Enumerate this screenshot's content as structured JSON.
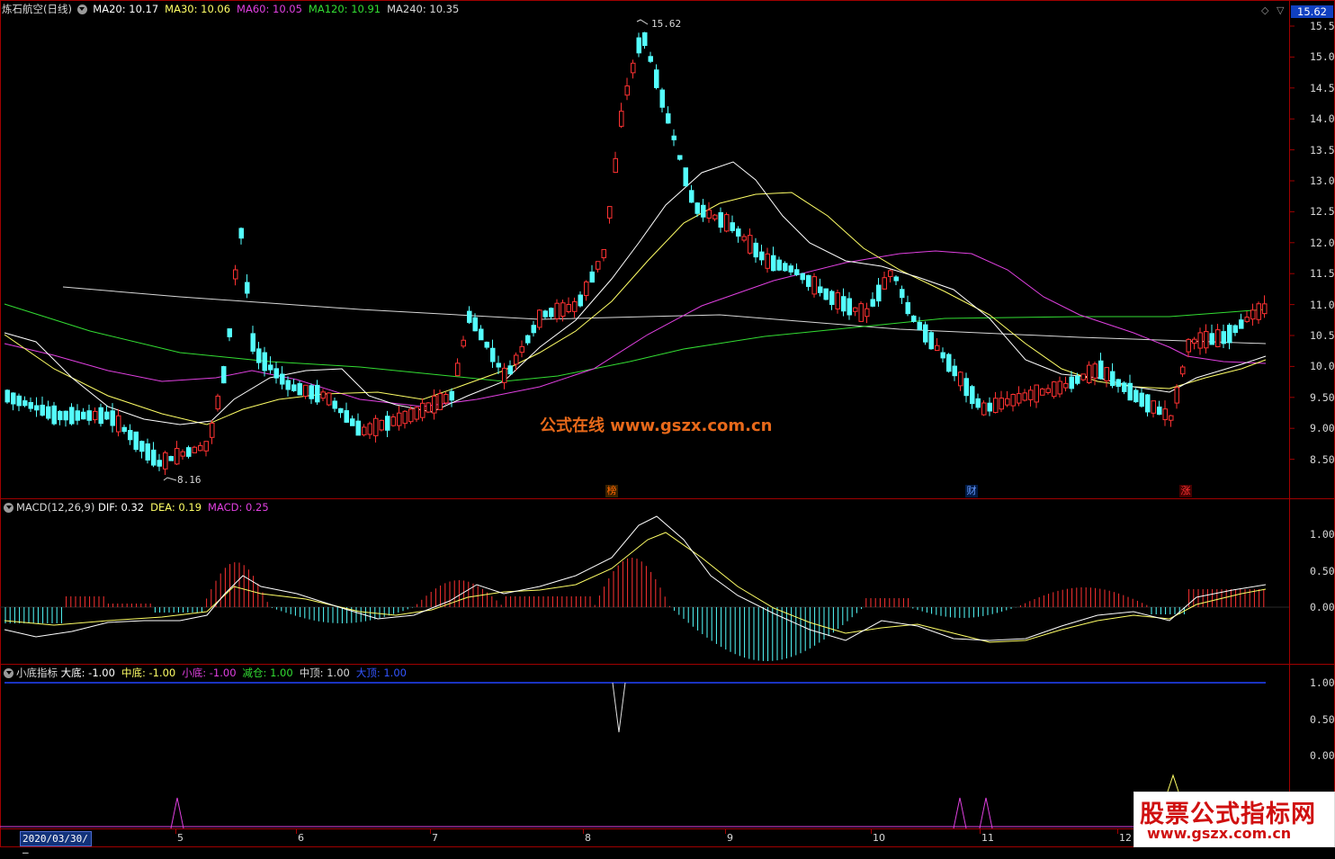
{
  "header": {
    "stock_name": "炼石航空",
    "period": "(日线)",
    "ma_items": [
      {
        "label": "MA20: 10.17",
        "color": "#ffffff"
      },
      {
        "label": "MA30: 10.06",
        "color": "#ffff66"
      },
      {
        "label": "MA60: 10.05",
        "color": "#e040e0"
      },
      {
        "label": "MA120: 10.91",
        "color": "#33dd33"
      },
      {
        "label": "MA240: 10.35",
        "color": "#d8d8d8"
      }
    ],
    "current_price": "15.62"
  },
  "price_axis": [
    "15.50",
    "15.00",
    "14.50",
    "14.00",
    "13.50",
    "13.00",
    "12.50",
    "12.00",
    "11.50",
    "11.00",
    "10.50",
    "10.00",
    "9.50",
    "9.00",
    "8.50"
  ],
  "annotations": {
    "high": "15.62",
    "low": "8.16"
  },
  "watermark": "公式在线  www.gszx.com.cn",
  "badges": [
    {
      "text": "榜",
      "color": "#ff6600",
      "bg": "#3a2200"
    },
    {
      "text": "财",
      "color": "#6699ff",
      "bg": "#001a44"
    },
    {
      "text": "涨",
      "color": "#ff3333",
      "bg": "#440000"
    }
  ],
  "macd": {
    "title": "MACD(12,26,9)",
    "items": [
      {
        "label": "DIF: 0.32",
        "color": "#ffffff"
      },
      {
        "label": "DEA: 0.19",
        "color": "#ffff66"
      },
      {
        "label": "MACD: 0.25",
        "color": "#e040e0"
      }
    ],
    "axis": [
      "1.00",
      "0.50",
      "0.00"
    ]
  },
  "indicator": {
    "title": "小底指标",
    "items": [
      {
        "label": "大底: -1.00",
        "color": "#ffffff"
      },
      {
        "label": "中底: -1.00",
        "color": "#ffff66"
      },
      {
        "label": "小底: -1.00",
        "color": "#e040e0"
      },
      {
        "label": "减仓: 1.00",
        "color": "#33dd33"
      },
      {
        "label": "中顶: 1.00",
        "color": "#d8d8d8"
      },
      {
        "label": "大顶: 1.00",
        "color": "#3355ff"
      }
    ],
    "axis": [
      "1.00",
      "0.50",
      "0.00"
    ]
  },
  "time_axis": {
    "date_box": "2020/03/30/—",
    "months": [
      "5",
      "6",
      "7",
      "8",
      "9",
      "10",
      "11",
      "12"
    ]
  },
  "logo": {
    "line1": "股票公式指标网",
    "line2": "www.gszx.com.cn"
  },
  "colors": {
    "up": "#ff3232",
    "down": "#54ffff",
    "frame": "#a00000"
  }
}
